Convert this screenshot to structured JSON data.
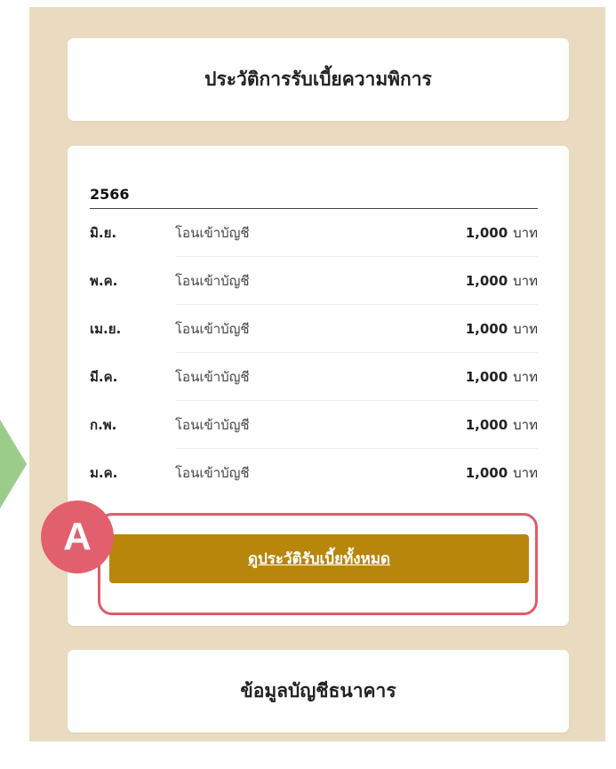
{
  "header": {
    "title": "ประวัติการรับเบี้ยความพิการ"
  },
  "history": {
    "year": "2566",
    "transactions": [
      {
        "month": "มิ.ย.",
        "description": "โอนเข้าบัญชี",
        "amount": "1,000",
        "unit": "บาท"
      },
      {
        "month": "พ.ค.",
        "description": "โอนเข้าบัญชี",
        "amount": "1,000",
        "unit": "บาท"
      },
      {
        "month": "เม.ย.",
        "description": "โอนเข้าบัญชี",
        "amount": "1,000",
        "unit": "บาท"
      },
      {
        "month": "มี.ค.",
        "description": "โอนเข้าบัญชี",
        "amount": "1,000",
        "unit": "บาท"
      },
      {
        "month": "ก.พ.",
        "description": "โอนเข้าบัญชี",
        "amount": "1,000",
        "unit": "บาท"
      },
      {
        "month": "ม.ค.",
        "description": "โอนเข้าบัญชี",
        "amount": "1,000",
        "unit": "บาท"
      }
    ],
    "view_all_label": "ดูประวัติรับเบี้ยทั้งหมด",
    "badge_label": "A"
  },
  "bank": {
    "title": "ข้อมูลบัญชีธนาคาร"
  },
  "colors": {
    "panel_bg": "#eadbc0",
    "button_bg": "#b8860b",
    "highlight": "#e05c6c",
    "badge_bg": "#e25f6e",
    "arrow": "#9ccc8a"
  }
}
